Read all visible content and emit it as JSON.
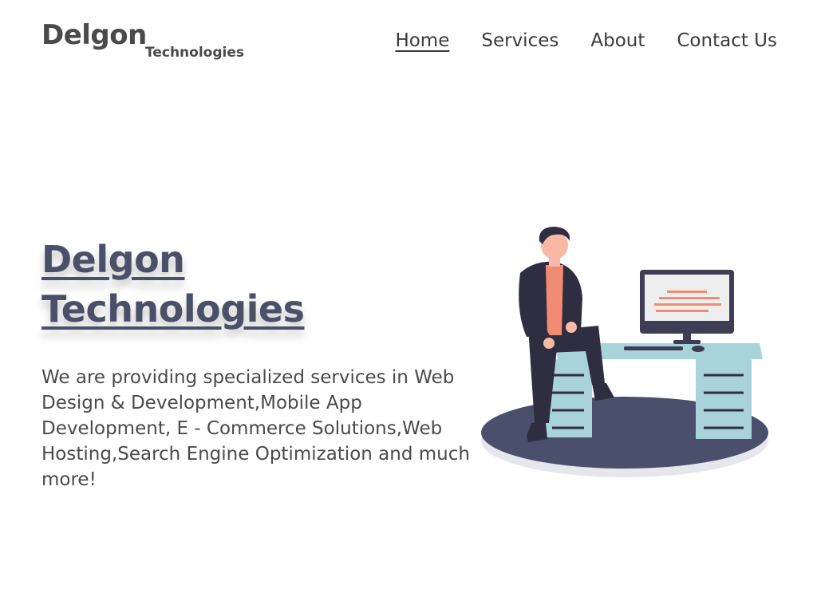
{
  "header": {
    "logo": {
      "main": "Delgon",
      "sub": "Technologies"
    },
    "nav": [
      {
        "label": "Home",
        "active": true
      },
      {
        "label": "Services",
        "active": false
      },
      {
        "label": "About",
        "active": false
      },
      {
        "label": "Contact Us",
        "active": false
      }
    ]
  },
  "hero": {
    "title_line1": "Delgon",
    "title_line2": "Technologies",
    "description": "We are providing specialized services in Web Design & Development,Mobile App Development, E - Commerce Solutions,Web Hosting,Search Engine Optimization and much more!"
  },
  "illustration": {
    "name": "person-sitting-on-desk-with-computer",
    "colors": {
      "floor": "#4a4f6b",
      "desk": "#a8d3da",
      "skin": "#f7b9a6",
      "shirt": "#f28b74",
      "jacket": "#2f2e41",
      "screen_code": "#f28b74"
    }
  },
  "colors": {
    "title": "#4a5068",
    "text": "#4a4a4a",
    "nav": "#3a3a3a"
  }
}
